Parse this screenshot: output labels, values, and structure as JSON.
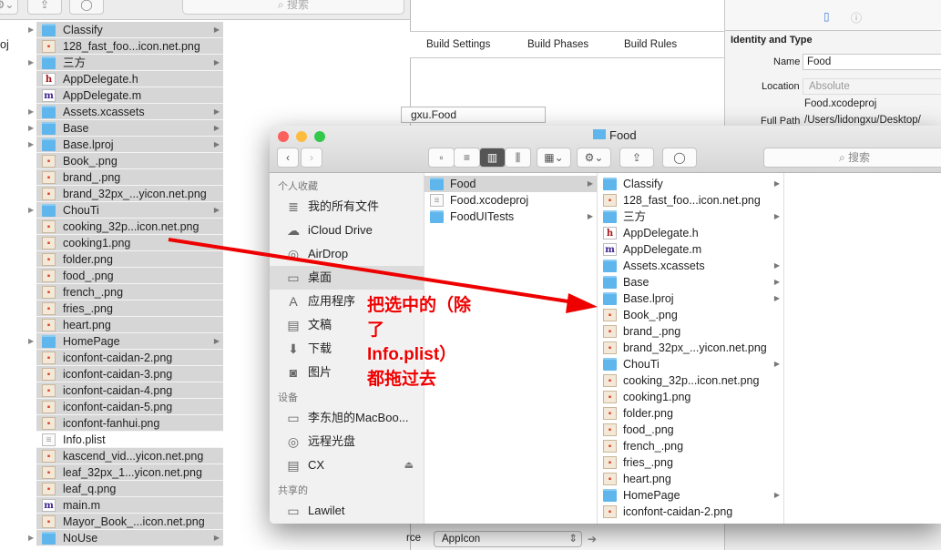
{
  "background_window": {
    "search_placeholder": "搜索",
    "parent_item": "oj",
    "items": [
      {
        "name": "Classify",
        "icon": "folder",
        "arrow": true
      },
      {
        "name": "128_fast_foo...icon.net.png",
        "icon": "png"
      },
      {
        "name": "三方",
        "icon": "folder",
        "arrow": true
      },
      {
        "name": "AppDelegate.h",
        "icon": "h"
      },
      {
        "name": "AppDelegate.m",
        "icon": "m"
      },
      {
        "name": "Assets.xcassets",
        "icon": "folder",
        "arrow": true
      },
      {
        "name": "Base",
        "icon": "folder",
        "arrow": true
      },
      {
        "name": "Base.lproj",
        "icon": "folder",
        "arrow": true
      },
      {
        "name": "Book_.png",
        "icon": "png"
      },
      {
        "name": "brand_.png",
        "icon": "png"
      },
      {
        "name": "brand_32px_...yicon.net.png",
        "icon": "png"
      },
      {
        "name": "ChouTi",
        "icon": "folder",
        "arrow": true
      },
      {
        "name": "cooking_32p...icon.net.png",
        "icon": "png"
      },
      {
        "name": "cooking1.png",
        "icon": "png"
      },
      {
        "name": "folder.png",
        "icon": "png"
      },
      {
        "name": "food_.png",
        "icon": "png"
      },
      {
        "name": "french_.png",
        "icon": "png"
      },
      {
        "name": "fries_.png",
        "icon": "png"
      },
      {
        "name": "heart.png",
        "icon": "png"
      },
      {
        "name": "HomePage",
        "icon": "folder",
        "arrow": true
      },
      {
        "name": "iconfont-caidan-2.png",
        "icon": "png"
      },
      {
        "name": "iconfont-caidan-3.png",
        "icon": "png"
      },
      {
        "name": "iconfont-caidan-4.png",
        "icon": "png"
      },
      {
        "name": "iconfont-caidan-5.png",
        "icon": "png"
      },
      {
        "name": "iconfont-fanhui.png",
        "icon": "png"
      },
      {
        "name": "Info.plist",
        "icon": "plist",
        "unselected": true
      },
      {
        "name": "kascend_vid...yicon.net.png",
        "icon": "png"
      },
      {
        "name": "leaf_32px_1...yicon.net.png",
        "icon": "png"
      },
      {
        "name": "leaf_q.png",
        "icon": "png"
      },
      {
        "name": "main.m",
        "icon": "m"
      },
      {
        "name": "Mayor_Book_...icon.net.png",
        "icon": "png"
      },
      {
        "name": "NoUse",
        "icon": "folder",
        "arrow": true
      }
    ]
  },
  "xcode": {
    "tabs": [
      "Build Settings",
      "Build Phases",
      "Build Rules"
    ],
    "bundle_id_fragment": "gxu.Food",
    "source_label": "rce",
    "source_value": "AppIcon",
    "inspector": {
      "section": "Identity and Type",
      "name_label": "Name",
      "name_value": "Food",
      "location_label": "Location",
      "location_value": "Absolute",
      "file_name": "Food.xcodeproj",
      "full_path_label": "Full Path",
      "full_path_value": "/Users/lidongxu/Desktop/"
    }
  },
  "finder": {
    "title": "Food",
    "search_placeholder": "搜索",
    "sidebar": {
      "favorites_header": "个人收藏",
      "favorites": [
        {
          "label": "我的所有文件",
          "icon": "≣"
        },
        {
          "label": "iCloud Drive",
          "icon": "☁"
        },
        {
          "label": "AirDrop",
          "icon": "◎"
        },
        {
          "label": "桌面",
          "icon": "▭",
          "active": true
        },
        {
          "label": "应用程序",
          "icon": "A"
        },
        {
          "label": "文稿",
          "icon": "▤"
        },
        {
          "label": "下载",
          "icon": "⬇"
        },
        {
          "label": "图片",
          "icon": "◙"
        }
      ],
      "devices_header": "设备",
      "devices": [
        {
          "label": "李东旭的MacBoo...",
          "icon": "▭"
        },
        {
          "label": "远程光盘",
          "icon": "◎"
        },
        {
          "label": "CX",
          "icon": "▤",
          "eject": "⏏"
        }
      ],
      "shared_header": "共享的",
      "shared": [
        {
          "label": "Lawilet",
          "icon": "▭"
        }
      ]
    },
    "column1": [
      {
        "name": "Food",
        "icon": "folder",
        "arrow": true,
        "selected": true
      },
      {
        "name": "Food.xcodeproj",
        "icon": "plist"
      },
      {
        "name": "FoodUITests",
        "icon": "folder",
        "arrow": true
      }
    ],
    "column2": [
      {
        "name": "Classify",
        "icon": "folder",
        "arrow": true
      },
      {
        "name": "128_fast_foo...icon.net.png",
        "icon": "png"
      },
      {
        "name": "三方",
        "icon": "folder",
        "arrow": true
      },
      {
        "name": "AppDelegate.h",
        "icon": "h"
      },
      {
        "name": "AppDelegate.m",
        "icon": "m"
      },
      {
        "name": "Assets.xcassets",
        "icon": "folder",
        "arrow": true
      },
      {
        "name": "Base",
        "icon": "folder",
        "arrow": true
      },
      {
        "name": "Base.lproj",
        "icon": "folder",
        "arrow": true
      },
      {
        "name": "Book_.png",
        "icon": "png"
      },
      {
        "name": "brand_.png",
        "icon": "png"
      },
      {
        "name": "brand_32px_...yicon.net.png",
        "icon": "png"
      },
      {
        "name": "ChouTi",
        "icon": "folder",
        "arrow": true
      },
      {
        "name": "cooking_32p...icon.net.png",
        "icon": "png"
      },
      {
        "name": "cooking1.png",
        "icon": "png"
      },
      {
        "name": "folder.png",
        "icon": "png"
      },
      {
        "name": "food_.png",
        "icon": "png"
      },
      {
        "name": "french_.png",
        "icon": "png"
      },
      {
        "name": "fries_.png",
        "icon": "png"
      },
      {
        "name": "heart.png",
        "icon": "png"
      },
      {
        "name": "HomePage",
        "icon": "folder",
        "arrow": true
      },
      {
        "name": "iconfont-caidan-2.png",
        "icon": "png"
      }
    ]
  },
  "annotation": {
    "lines": [
      "把选中的（除",
      "了",
      "Info.plist）",
      "都拖过去"
    ],
    "color": "#e00000"
  }
}
